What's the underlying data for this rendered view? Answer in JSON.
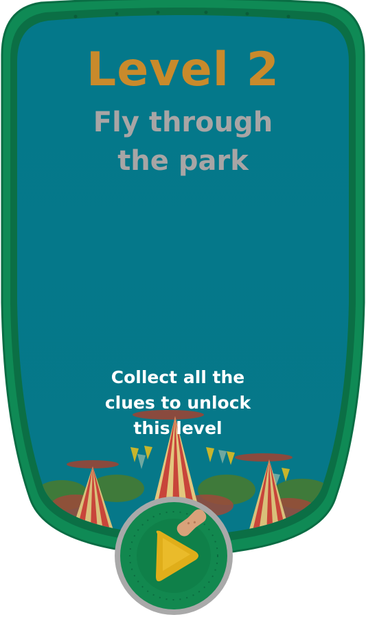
{
  "level": {
    "title": "Level 2",
    "subtitle_line1": "Fly through",
    "subtitle_line2": "the park",
    "lock_line1": "Collect all the",
    "lock_line2": "clues to unlock",
    "lock_line3": "this level"
  },
  "colors": {
    "card_fill": "#037b8b",
    "frame_green": "#0f8a55",
    "frame_dark": "#0b6f45",
    "title_orange": "#c98a2b",
    "subtitle_grey": "#a8a5a5",
    "play_triangle": "#e0ae1a",
    "bandage": "#d9a27a"
  },
  "icons": {
    "play": "play-triangle-icon",
    "bandage": "bandage-icon"
  }
}
